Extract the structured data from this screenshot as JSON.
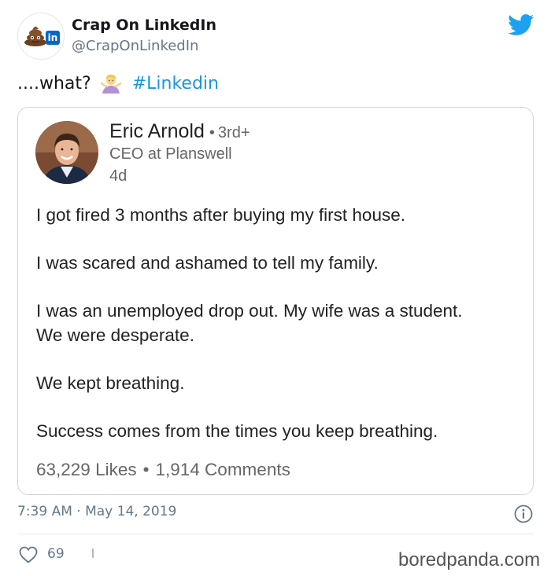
{
  "account": {
    "display_name": "Crap On LinkedIn",
    "handle": "@CrapOnLinkedIn",
    "avatar_badge": "in"
  },
  "tweet": {
    "text_prefix": "....what?",
    "emoji": "person-shrugging",
    "hashtag": "#Linkedin",
    "timestamp": "7:39 AM · May 14, 2019",
    "likes": "69"
  },
  "embedded_post": {
    "author": "Eric Arnold",
    "separator": "•",
    "degree": "3rd+",
    "title": "CEO at Planswell",
    "age": "4d",
    "lines": [
      "I got fired 3 months after buying my first house.",
      "I was scared and ashamed to tell my family.",
      "I was an unemployed drop out. My wife was a student.",
      "We were desperate.",
      "We kept breathing.",
      "Success comes from the times you keep breathing."
    ],
    "likes": "63,229 Likes",
    "bullet": "•",
    "comments": "1,914 Comments"
  },
  "watermark": "boredpanda.com",
  "colors": {
    "twitter_blue": "#1da1f2",
    "hashtag": "#1b95e0",
    "linkedin_blue": "#0a66c2",
    "muted": "#657786"
  },
  "icons": [
    "pile-of-poo-icon",
    "linkedin-icon",
    "twitter-bird-icon",
    "shrug-emoji-icon",
    "info-icon",
    "heart-icon"
  ]
}
